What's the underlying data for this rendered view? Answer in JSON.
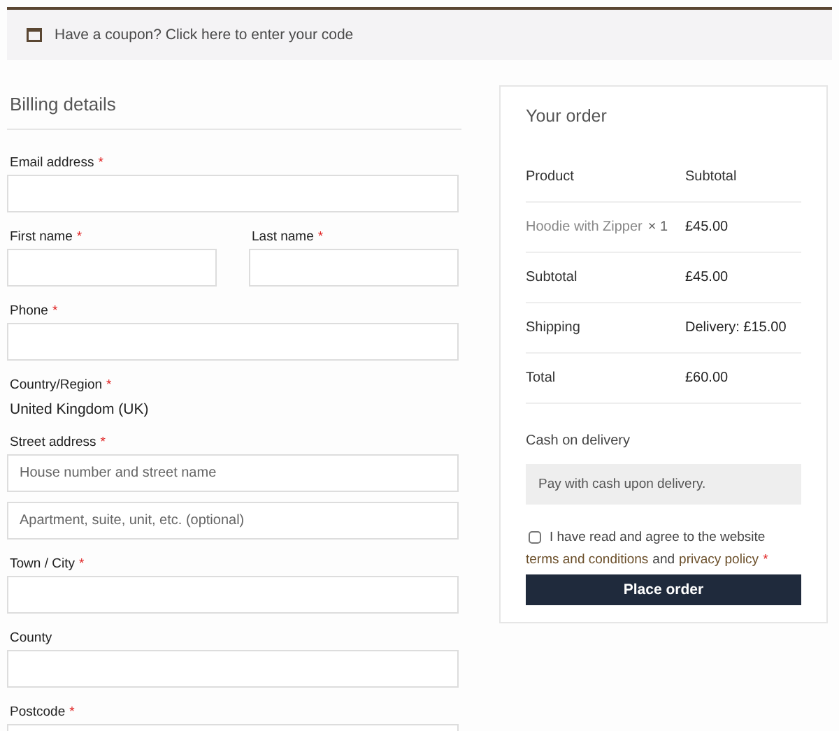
{
  "coupon_bar": {
    "text": "Have a coupon? Click here to enter your code"
  },
  "billing": {
    "title": "Billing details",
    "fields": [
      {
        "kind": "input",
        "label": "Email address",
        "required_mark": "*"
      },
      {
        "kind": "pair",
        "items": [
          {
            "label": "First name",
            "required_mark": "*"
          },
          {
            "label": "Last name",
            "required_mark": "*"
          }
        ]
      },
      {
        "kind": "input",
        "label": "Phone",
        "required_mark": "*"
      },
      {
        "kind": "static",
        "label": "Country/Region",
        "required_mark": "*",
        "value": "United Kingdom (UK)"
      },
      {
        "kind": "input",
        "label": "Street address",
        "required_mark": "*",
        "placeholder": "House number and street name"
      },
      {
        "kind": "input",
        "placeholder": "Apartment, suite, unit, etc. (optional)"
      },
      {
        "kind": "input",
        "label": "Town / City",
        "required_mark": "*"
      },
      {
        "kind": "input",
        "label": "County"
      },
      {
        "kind": "input",
        "label": "Postcode",
        "required_mark": "*"
      }
    ]
  },
  "order": {
    "title": "Your order",
    "columns": [
      "Product",
      "Subtotal"
    ],
    "items": [
      {
        "name": "Hoodie with Zipper",
        "qty": "× 1",
        "price": "£45.00"
      }
    ],
    "totals": [
      {
        "label": "Subtotal",
        "value": "£45.00"
      },
      {
        "label": "Shipping",
        "value": "Delivery: £15.00"
      },
      {
        "label": "Total",
        "value": "£60.00"
      }
    ],
    "payment": {
      "method": "Cash on delivery",
      "description": "Pay with cash upon delivery."
    },
    "terms": {
      "checked": false,
      "text": "I have read and agree to the website",
      "link1": "terms and conditions",
      "joiner": "and",
      "link2": "privacy policy",
      "required_mark": "*"
    },
    "button": "Place order"
  }
}
